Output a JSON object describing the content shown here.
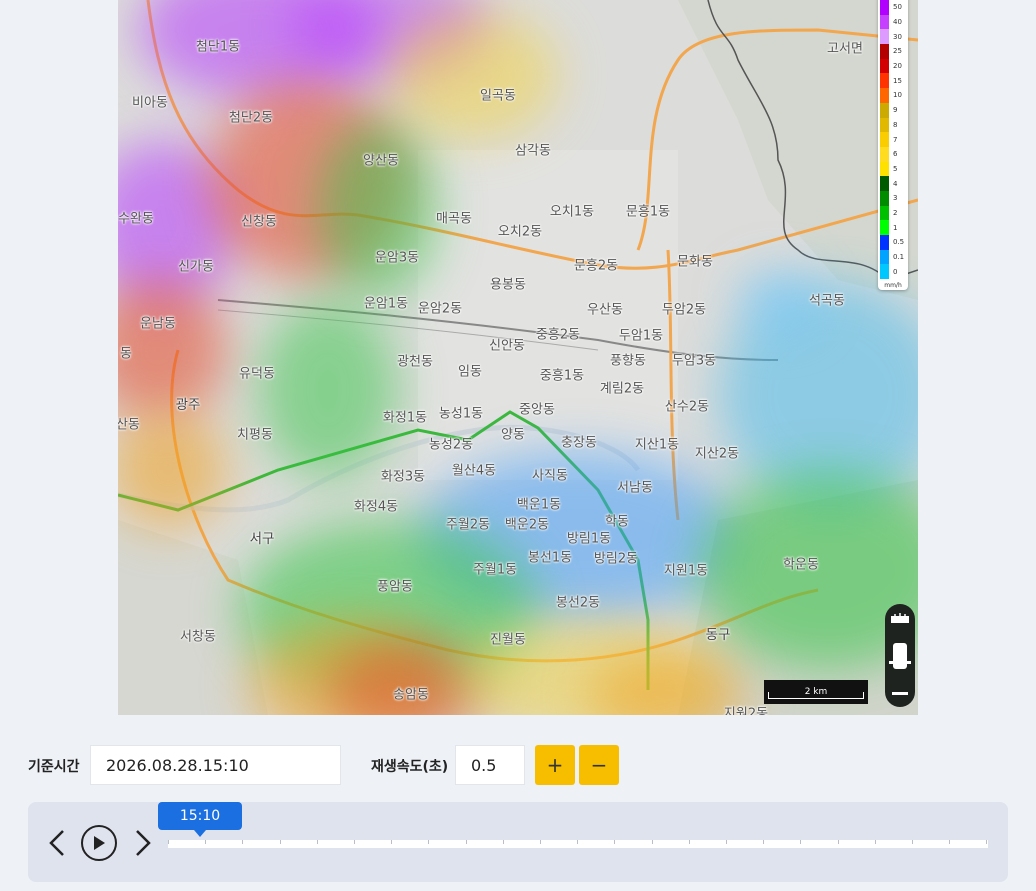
{
  "map": {
    "places": [
      {
        "name": "첨단1동",
        "big": false
      },
      {
        "name": "비아동",
        "big": false
      },
      {
        "name": "첨단2동",
        "big": false
      },
      {
        "name": "일곡동",
        "big": false
      },
      {
        "name": "삼각동",
        "big": false
      },
      {
        "name": "양산동",
        "big": false
      },
      {
        "name": "고서면",
        "big": false
      },
      {
        "name": "수완동",
        "big": false
      },
      {
        "name": "신창동",
        "big": false
      },
      {
        "name": "매곡동",
        "big": false
      },
      {
        "name": "오치1동",
        "big": false
      },
      {
        "name": "문흥1동",
        "big": false
      },
      {
        "name": "오치2동",
        "big": false
      },
      {
        "name": "신가동",
        "big": false
      },
      {
        "name": "운암3동",
        "big": false
      },
      {
        "name": "문흥2동",
        "big": false
      },
      {
        "name": "문화동",
        "big": false
      },
      {
        "name": "용봉동",
        "big": false
      },
      {
        "name": "석곡동",
        "big": false
      },
      {
        "name": "운남동",
        "big": false
      },
      {
        "name": "운암1동",
        "big": false
      },
      {
        "name": "운암2동",
        "big": false
      },
      {
        "name": "우산동",
        "big": false
      },
      {
        "name": "두암2동",
        "big": false
      },
      {
        "name": "중흥2동",
        "big": false
      },
      {
        "name": "두암1동",
        "big": false
      },
      {
        "name": "동",
        "big": false
      },
      {
        "name": "신안동",
        "big": false
      },
      {
        "name": "광천동",
        "big": false
      },
      {
        "name": "풍향동",
        "big": false
      },
      {
        "name": "두암3동",
        "big": false
      },
      {
        "name": "유덕동",
        "big": false
      },
      {
        "name": "임동",
        "big": false
      },
      {
        "name": "중흥1동",
        "big": false
      },
      {
        "name": "계림2동",
        "big": false
      },
      {
        "name": "광주",
        "big": true
      },
      {
        "name": "산수2동",
        "big": false
      },
      {
        "name": "중앙동",
        "big": false
      },
      {
        "name": "화정1동",
        "big": false
      },
      {
        "name": "농성1동",
        "big": false
      },
      {
        "name": "산동",
        "big": false
      },
      {
        "name": "치평동",
        "big": false
      },
      {
        "name": "양동",
        "big": false
      },
      {
        "name": "충장동",
        "big": false
      },
      {
        "name": "지산1동",
        "big": false
      },
      {
        "name": "농성2동",
        "big": false
      },
      {
        "name": "지산2동",
        "big": false
      },
      {
        "name": "월산4동",
        "big": false
      },
      {
        "name": "화정3동",
        "big": false
      },
      {
        "name": "사직동",
        "big": false
      },
      {
        "name": "서남동",
        "big": false
      },
      {
        "name": "화정4동",
        "big": false
      },
      {
        "name": "백운1동",
        "big": false
      },
      {
        "name": "학동",
        "big": false
      },
      {
        "name": "주월2동",
        "big": false
      },
      {
        "name": "백운2동",
        "big": false
      },
      {
        "name": "서구",
        "big": true
      },
      {
        "name": "방림1동",
        "big": false
      },
      {
        "name": "봉선1동",
        "big": false
      },
      {
        "name": "방림2동",
        "big": false
      },
      {
        "name": "학운동",
        "big": false
      },
      {
        "name": "주월1동",
        "big": false
      },
      {
        "name": "지원1동",
        "big": false
      },
      {
        "name": "풍암동",
        "big": false
      },
      {
        "name": "봉선2동",
        "big": false
      },
      {
        "name": "서창동",
        "big": false
      },
      {
        "name": "진월동",
        "big": false
      },
      {
        "name": "동구",
        "big": true
      },
      {
        "name": "송암동",
        "big": false
      },
      {
        "name": "지원2동",
        "big": false
      }
    ],
    "legend": {
      "unit": "mm/h",
      "items": [
        {
          "label": "50",
          "color": "#b200ff"
        },
        {
          "label": "40",
          "color": "#c640ff"
        },
        {
          "label": "30",
          "color": "#dd9bff"
        },
        {
          "label": "25",
          "color": "#b30000"
        },
        {
          "label": "20",
          "color": "#d20000"
        },
        {
          "label": "15",
          "color": "#ff3300"
        },
        {
          "label": "10",
          "color": "#ff6600"
        },
        {
          "label": "9",
          "color": "#ccaa00"
        },
        {
          "label": "8",
          "color": "#e0b900"
        },
        {
          "label": "7",
          "color": "#f9cd00"
        },
        {
          "label": "6",
          "color": "#ffdc1f"
        },
        {
          "label": "5",
          "color": "#ffe100"
        },
        {
          "label": "4",
          "color": "#005a00"
        },
        {
          "label": "3",
          "color": "#008c00"
        },
        {
          "label": "2",
          "color": "#00be00"
        },
        {
          "label": "1",
          "color": "#00ff00"
        },
        {
          "label": "0.5",
          "color": "#0033ff"
        },
        {
          "label": "0.1",
          "color": "#00a3ff"
        },
        {
          "label": "0",
          "color": "#00c8ff"
        }
      ]
    },
    "scale_label": "2 km"
  },
  "controls": {
    "base_time_label": "기준시간",
    "base_time_value": "2026.08.28.15:10",
    "speed_label": "재생속도(초)",
    "speed_value": "0.5",
    "plus_label": "+",
    "minus_label": "−"
  },
  "player": {
    "current_time": "15:10",
    "progress": 0.0
  },
  "colors": {
    "accent_blue": "#1b6fe0",
    "accent_yellow": "#f7be00"
  }
}
